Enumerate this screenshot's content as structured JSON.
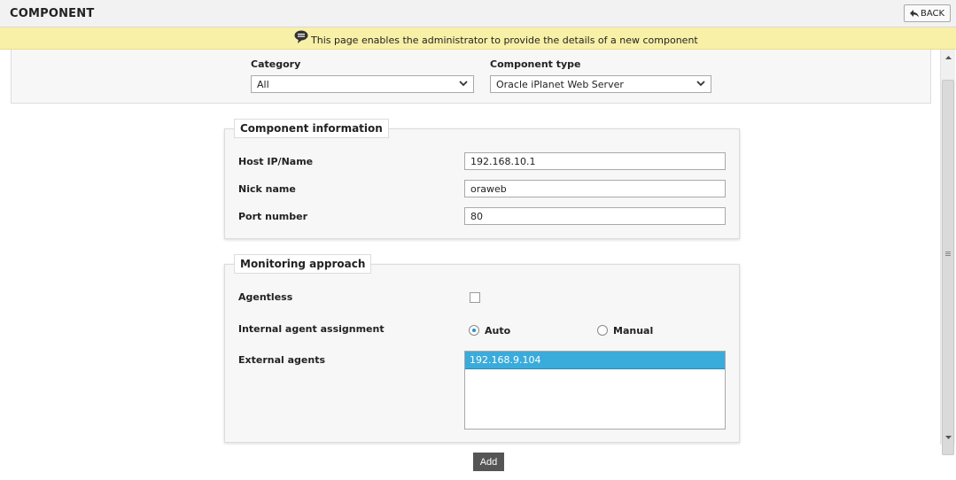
{
  "header": {
    "title": "COMPONENT",
    "back_label": "BACK"
  },
  "info_bar": {
    "message": "This page enables the administrator to provide the details of a new component"
  },
  "filters": {
    "category_label": "Category",
    "category_value": "All",
    "component_type_label": "Component type",
    "component_type_value": "Oracle iPlanet Web Server"
  },
  "component_information": {
    "legend": "Component information",
    "host_label": "Host IP/Name",
    "host_value": "192.168.10.1",
    "nick_label": "Nick name",
    "nick_value": "oraweb",
    "port_label": "Port number",
    "port_value": "80"
  },
  "monitoring_approach": {
    "legend": "Monitoring approach",
    "agentless_label": "Agentless",
    "agentless_checked": false,
    "assignment_label": "Internal agent assignment",
    "auto_label": "Auto",
    "manual_label": "Manual",
    "selected_assignment": "Auto",
    "external_agents_label": "External agents",
    "external_agents": [
      "192.168.9.104"
    ]
  },
  "actions": {
    "add_label": "Add"
  },
  "icons": {
    "back": "back-arrow-icon",
    "info": "speech-bubble-icon",
    "dropdown": "chevron-down-icon"
  },
  "colors": {
    "info_bar_bg": "#f9f0a8",
    "selected_option_bg": "#3aabdb",
    "add_button_bg": "#555555"
  }
}
